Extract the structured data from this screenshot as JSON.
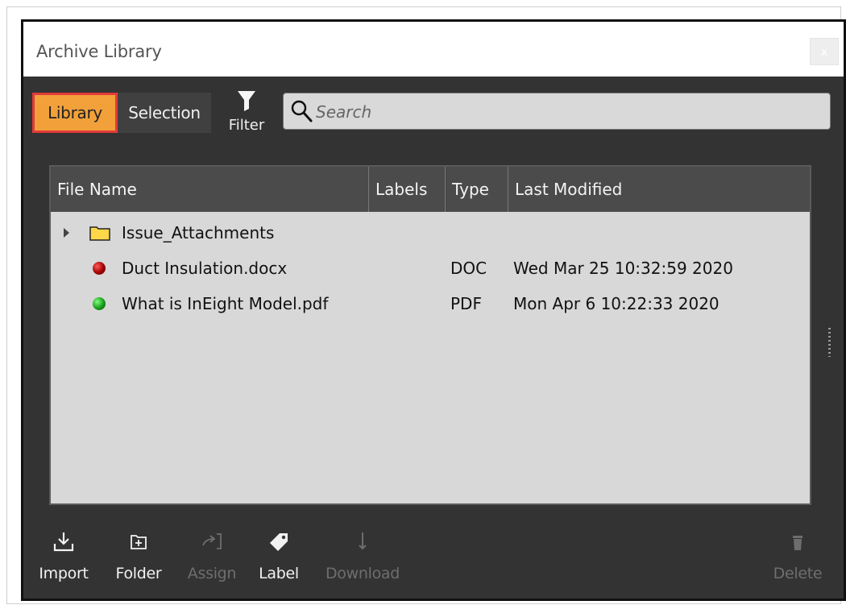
{
  "window": {
    "title": "Archive Library",
    "close_label": "x"
  },
  "tabs": [
    {
      "label": "Library",
      "active": true
    },
    {
      "label": "Selection",
      "active": false
    }
  ],
  "filter": {
    "label": "Filter",
    "icon": "funnel-icon"
  },
  "search": {
    "placeholder": "Search",
    "value": "",
    "icon": "search-icon"
  },
  "table": {
    "columns": [
      "File Name",
      "Labels",
      "Type",
      "Last Modified"
    ],
    "rows": [
      {
        "kind": "folder",
        "name": "Issue_Attachments",
        "labels": "",
        "type": "",
        "modified": "",
        "icon": "folder-icon"
      },
      {
        "kind": "file",
        "name": "Duct Insulation.docx",
        "labels": "",
        "type": "DOC",
        "modified": "Wed Mar 25 10:32:59 2020",
        "status_color": "#a00000"
      },
      {
        "kind": "file",
        "name": "What is InEight Model.pdf",
        "labels": "",
        "type": "PDF",
        "modified": "Mon Apr 6 10:22:33 2020",
        "status_color": "#1a9a1a"
      }
    ]
  },
  "toolbar": {
    "import_label": "Import",
    "folder_label": "Folder",
    "assign_label": "Assign",
    "label_label": "Label",
    "download_label": "Download",
    "delete_label": "Delete"
  },
  "colors": {
    "accent_tab": "#f2a13a",
    "tab_highlight_border": "#e23a3a",
    "window_bg": "#333333",
    "table_bg": "#d8d8d8"
  }
}
